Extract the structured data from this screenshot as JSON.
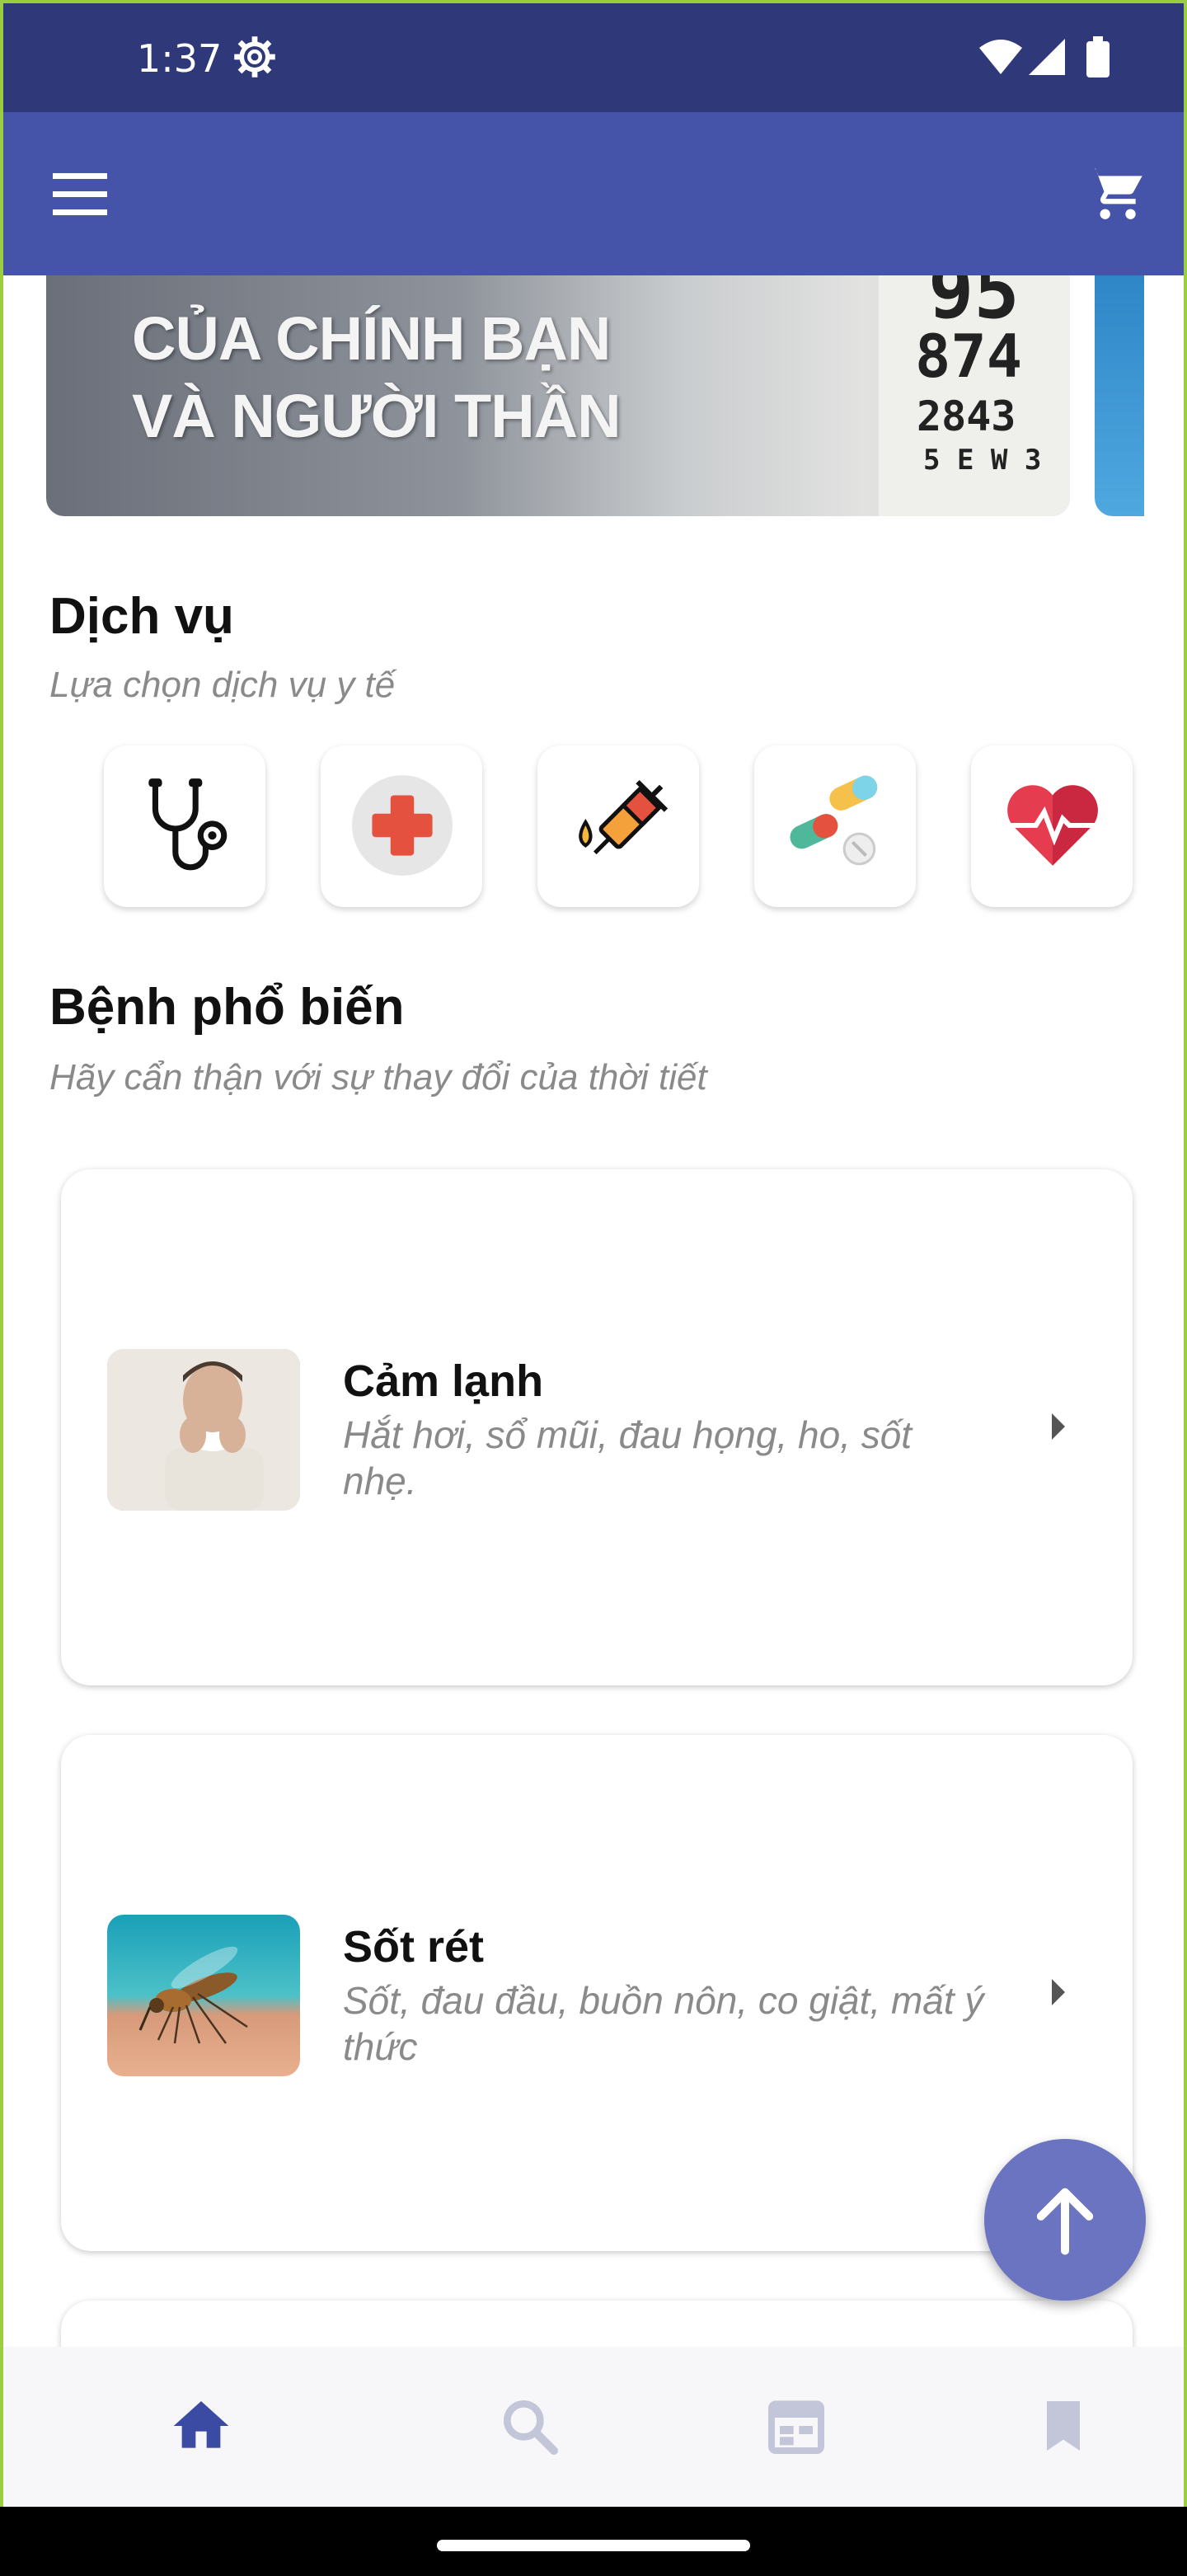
{
  "status_bar": {
    "time": "1:37"
  },
  "banner": {
    "line1": "CỦA CHÍNH BẠN",
    "line2": "VÀ NGƯỜI THẦN",
    "chart_row1": "95",
    "chart_row2": "874",
    "chart_row3": "2843",
    "chart_row4": "5 E W 3"
  },
  "services": {
    "title": "Dịch vụ",
    "subtitle": "Lựa chọn dịch vụ y tế",
    "items": [
      {
        "icon": "stethoscope-icon"
      },
      {
        "icon": "medical-cross-icon"
      },
      {
        "icon": "syringe-icon"
      },
      {
        "icon": "pills-icon"
      },
      {
        "icon": "heart-pulse-icon"
      }
    ]
  },
  "diseases": {
    "title": "Bệnh phổ biến",
    "subtitle": "Hãy cẩn thận với sự thay đổi của thời tiết",
    "items": [
      {
        "name": "Cảm lạnh",
        "description": "Hắt hơi, sổ mũi, đau họng, ho, sốt nhẹ."
      },
      {
        "name": "Sốt rét",
        "description": "Sốt, đau đầu, buồn nôn, co giật, mất ý thức"
      }
    ]
  },
  "bottom_nav": {
    "items": [
      {
        "icon": "home-icon",
        "active": true
      },
      {
        "icon": "search-icon"
      },
      {
        "icon": "calendar-icon"
      },
      {
        "icon": "bookmark-icon"
      }
    ]
  },
  "colors": {
    "primary": "#4553a8",
    "status_bar": "#2f3878",
    "fab": "#6b74c0",
    "nav_active": "#3b4aa3",
    "nav_inactive": "#c3c6d8"
  }
}
